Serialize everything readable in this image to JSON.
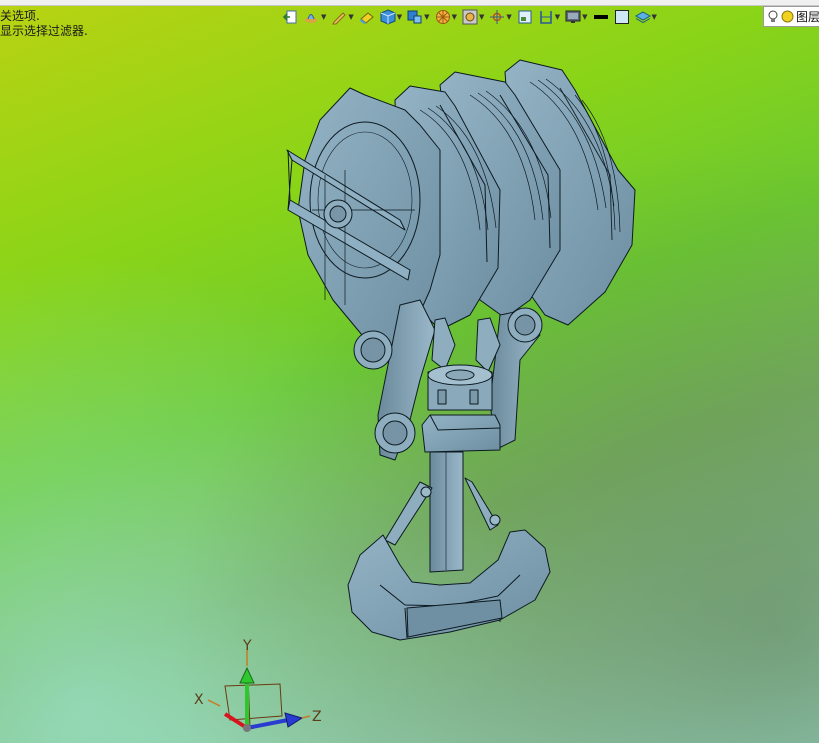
{
  "status": {
    "line1": "关选项.",
    "line2": "显示选择过滤器."
  },
  "toolbar": {
    "items": [
      {
        "name": "exit-sketch-icon",
        "dropdown": false
      },
      {
        "name": "render-style-icon",
        "dropdown": true
      },
      {
        "name": "pencil-icon",
        "dropdown": true
      },
      {
        "name": "eraser-icon",
        "dropdown": false
      },
      {
        "name": "view-cube-icon",
        "dropdown": true
      },
      {
        "name": "view-orient-icon",
        "dropdown": true
      },
      {
        "name": "section-wheel-icon",
        "dropdown": true
      },
      {
        "name": "display-mode-icon",
        "dropdown": true
      },
      {
        "name": "move-axes-icon",
        "dropdown": true
      },
      {
        "name": "frame-icon",
        "dropdown": false
      },
      {
        "name": "bracket-icon",
        "dropdown": true
      },
      {
        "name": "monitor-icon",
        "dropdown": true
      },
      {
        "name": "line-color-icon",
        "dropdown": false
      },
      {
        "name": "fill-color-icon",
        "dropdown": false
      },
      {
        "name": "layer-stack-icon",
        "dropdown": true
      }
    ]
  },
  "layer": {
    "label": "图层"
  },
  "triad": {
    "x_label": "X",
    "y_label": "Y",
    "z_label": "Z"
  },
  "colors": {
    "model_fill": "#7f9fb1",
    "model_edge": "#0d1a22",
    "accent_x": "#d8141c",
    "accent_y": "#2ec82e",
    "accent_z": "#2a3cd0"
  }
}
